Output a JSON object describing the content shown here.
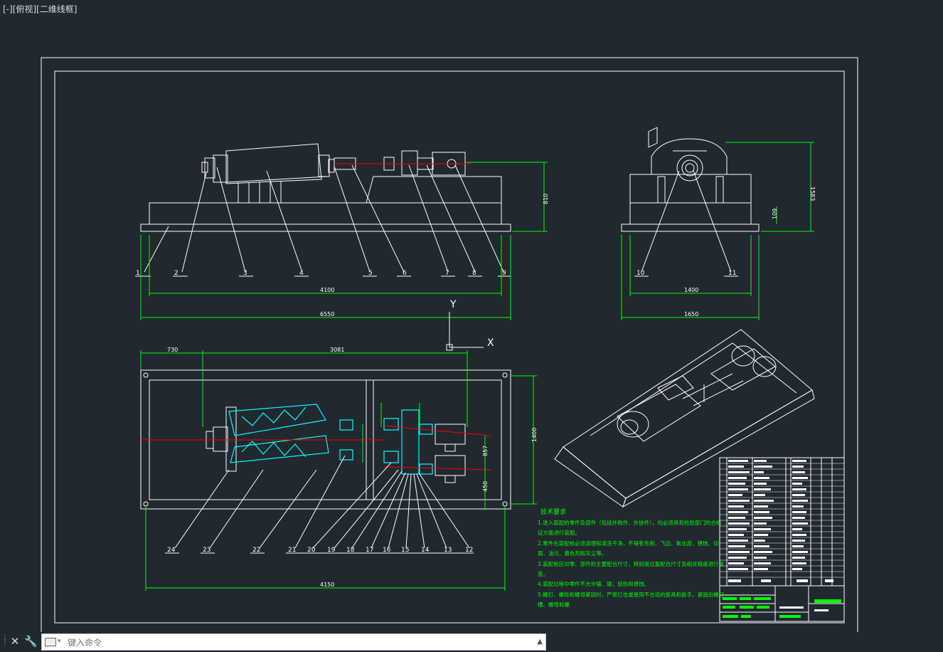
{
  "viewport": {
    "label": "[-][俯视][二维线框]"
  },
  "balloons": {
    "front": [
      "1",
      "2",
      "3",
      "4",
      "5",
      "6",
      "7",
      "8",
      "9"
    ],
    "side": [
      "10",
      "11"
    ],
    "plan": [
      "24",
      "23",
      "22",
      "21",
      "20",
      "19",
      "18",
      "17",
      "16",
      "15",
      "14",
      "13",
      "12"
    ]
  },
  "dims": {
    "front_len": "4100",
    "front_total": "6550",
    "front_height": "810",
    "side_width": "1400",
    "side_total": "1650",
    "side_height": "1583",
    "side_small": "109",
    "plan_top_left": "730",
    "plan_top_right": "3081",
    "plan_right": "1400",
    "plan_mid": "857",
    "plan_low": "450",
    "plan_bottom": "4150"
  },
  "ucs": {
    "y": "Y",
    "x": "X"
  },
  "tech": {
    "title": "技术要求",
    "lines": [
      "1.进入装配的零件及部件（包括外购件、外协件），均必须具有检验部门的合格",
      "证方能进行装配。",
      "2.零件在装配前必须清理和清洗干净，不得有毛刺、飞边、氧化皮、锈蚀、切",
      "屑、油污、着色剂和灰尘等。",
      "3.装配前应对零、部件的主要配合尺寸，特别是过盈配合尺寸及相关精度进行复",
      "查。",
      "4.装配过程中零件不允许磕、碰、划伤和锈蚀。",
      "5.螺钉、螺栓和螺母紧固时，严禁打击或使用不合适的旋具和扳手。紧固后螺钉",
      "槽、螺母和螺"
    ]
  },
  "colors": {
    "bg": "#212830",
    "line": "#ffffff",
    "dim": "#00ff00",
    "cyan": "#00ffff",
    "red": "#ff0000",
    "text": "#d8dde3"
  },
  "cmd": {
    "placeholder": "键入命令"
  }
}
